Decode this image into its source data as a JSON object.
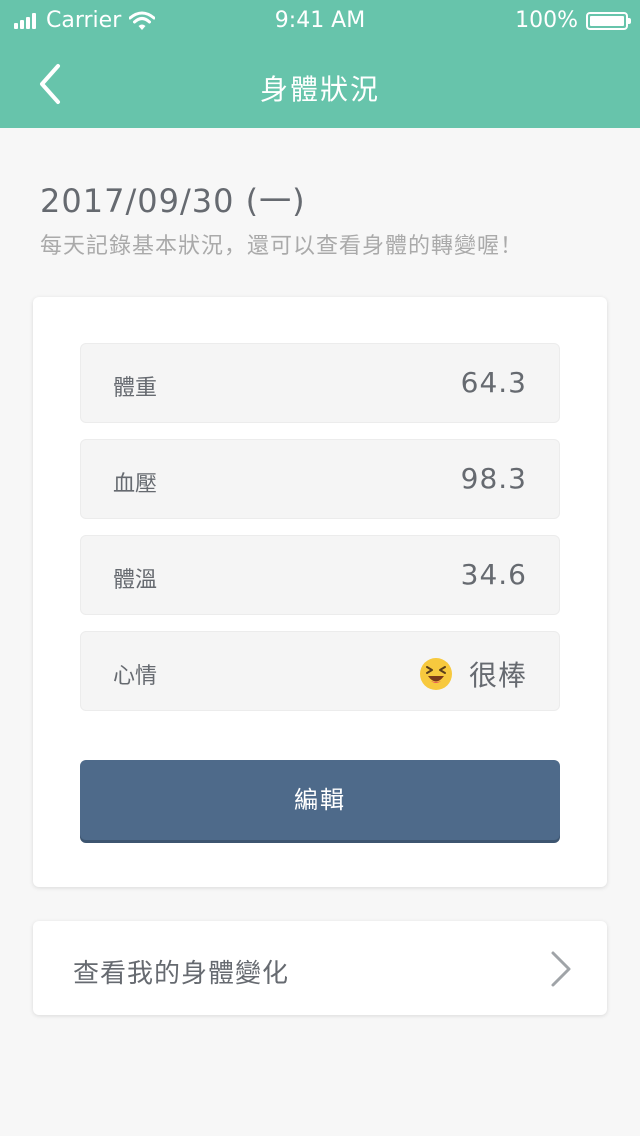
{
  "status_bar": {
    "carrier": "Carrier",
    "time": "9:41 AM",
    "battery": "100%"
  },
  "nav": {
    "title": "身體狀況",
    "back_icon": "chevron-left-icon"
  },
  "date": "2017/09/30 (一)",
  "subtitle": "每天記錄基本狀況，還可以查看身體的轉變喔！",
  "metrics": [
    {
      "label": "體重",
      "value": "64.3"
    },
    {
      "label": "血壓",
      "value": "98.3"
    },
    {
      "label": "體溫",
      "value": "34.6"
    }
  ],
  "mood": {
    "label": "心情",
    "value": "很棒",
    "icon": "grinning-squinting-emoji-icon"
  },
  "edit_button": "編輯",
  "link": {
    "label": "查看我的身體變化",
    "icon": "chevron-right-icon"
  },
  "colors": {
    "header": "#67c4ab",
    "button": "#4e6a8a",
    "background": "#f7f7f7"
  }
}
